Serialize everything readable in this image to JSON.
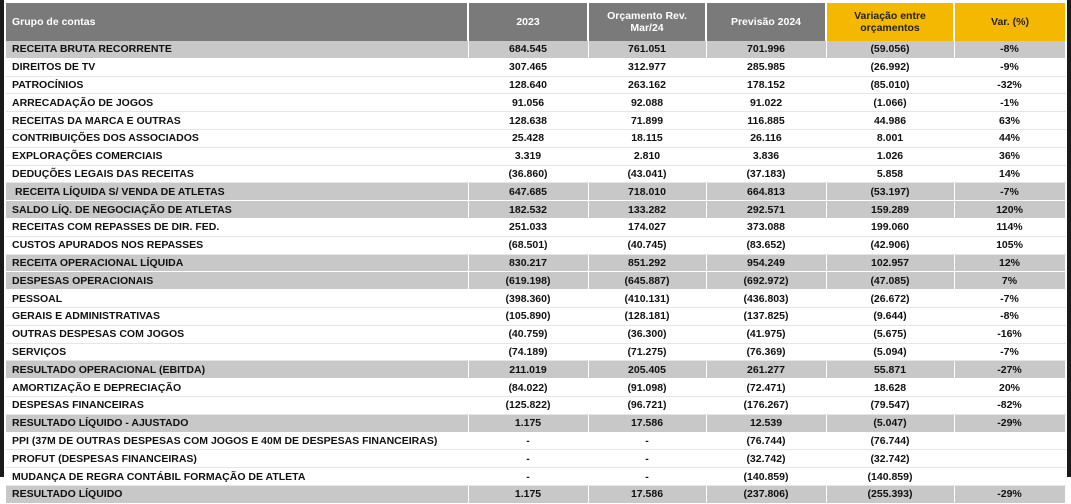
{
  "headers": [
    "Grupo de contas",
    "2023",
    "Orçamento Rev. Mar/24",
    "Previsão 2024",
    "Variação entre orçamentos",
    "Var. (%)"
  ],
  "rows": [
    {
      "label": "RECEITA BRUTA RECORRENTE",
      "v2023": "684.545",
      "orc": "761.051",
      "prev": "701.996",
      "var": "(59.056)",
      "pct": "-8%",
      "style": "total"
    },
    {
      "label": "DIREITOS DE TV",
      "v2023": "307.465",
      "orc": "312.977",
      "prev": "285.985",
      "var": "(26.992)",
      "pct": "-9%",
      "style": "normal"
    },
    {
      "label": "PATROCÍNIOS",
      "v2023": "128.640",
      "orc": "263.162",
      "prev": "178.152",
      "var": "(85.010)",
      "pct": "-32%",
      "style": "normal"
    },
    {
      "label": "ARRECADAÇÃO DE JOGOS",
      "v2023": "91.056",
      "orc": "92.088",
      "prev": "91.022",
      "var": "(1.066)",
      "pct": "-1%",
      "style": "normal"
    },
    {
      "label": "RECEITAS DA MARCA E OUTRAS",
      "v2023": "128.638",
      "orc": "71.899",
      "prev": "116.885",
      "var": "44.986",
      "pct": "63%",
      "style": "normal"
    },
    {
      "label": "CONTRIBUIÇÕES DOS ASSOCIADOS",
      "v2023": "25.428",
      "orc": "18.115",
      "prev": "26.116",
      "var": "8.001",
      "pct": "44%",
      "style": "normal"
    },
    {
      "label": "EXPLORAÇÕES COMERCIAIS",
      "v2023": "3.319",
      "orc": "2.810",
      "prev": "3.836",
      "var": "1.026",
      "pct": "36%",
      "style": "normal"
    },
    {
      "label": "DEDUÇÕES LEGAIS DAS RECEITAS",
      "v2023": "(36.860)",
      "orc": "(43.041)",
      "prev": "(37.183)",
      "var": "5.858",
      "pct": "14%",
      "style": "normal"
    },
    {
      "label": "RECEITA LÍQUIDA S/ VENDA DE ATLETAS",
      "v2023": "647.685",
      "orc": "718.010",
      "prev": "664.813",
      "var": "(53.197)",
      "pct": "-7%",
      "style": "total indent"
    },
    {
      "label": "SALDO LÍQ. DE NEGOCIAÇÃO DE ATLETAS",
      "v2023": "182.532",
      "orc": "133.282",
      "prev": "292.571",
      "var": "159.289",
      "pct": "120%",
      "style": "total"
    },
    {
      "label": "RECEITAS COM REPASSES DE DIR. FED.",
      "v2023": "251.033",
      "orc": "174.027",
      "prev": "373.088",
      "var": "199.060",
      "pct": "114%",
      "style": "normal"
    },
    {
      "label": "CUSTOS APURADOS NOS REPASSES",
      "v2023": "(68.501)",
      "orc": "(40.745)",
      "prev": "(83.652)",
      "var": "(42.906)",
      "pct": "105%",
      "style": "normal"
    },
    {
      "label": "RECEITA OPERACIONAL LÍQUIDA",
      "v2023": "830.217",
      "orc": "851.292",
      "prev": "954.249",
      "var": "102.957",
      "pct": "12%",
      "style": "total"
    },
    {
      "label": "DESPESAS OPERACIONAIS",
      "v2023": "(619.198)",
      "orc": "(645.887)",
      "prev": "(692.972)",
      "var": "(47.085)",
      "pct": "7%",
      "style": "total"
    },
    {
      "label": "PESSOAL",
      "v2023": "(398.360)",
      "orc": "(410.131)",
      "prev": "(436.803)",
      "var": "(26.672)",
      "pct": "-7%",
      "style": "normal"
    },
    {
      "label": "GERAIS E ADMINISTRATIVAS",
      "v2023": "(105.890)",
      "orc": "(128.181)",
      "prev": "(137.825)",
      "var": "(9.644)",
      "pct": "-8%",
      "style": "normal"
    },
    {
      "label": "OUTRAS DESPESAS COM JOGOS",
      "v2023": "(40.759)",
      "orc": "(36.300)",
      "prev": "(41.975)",
      "var": "(5.675)",
      "pct": "-16%",
      "style": "normal"
    },
    {
      "label": "SERVIÇOS",
      "v2023": "(74.189)",
      "orc": "(71.275)",
      "prev": "(76.369)",
      "var": "(5.094)",
      "pct": "-7%",
      "style": "normal"
    },
    {
      "label": "RESULTADO OPERACIONAL (EBITDA)",
      "v2023": "211.019",
      "orc": "205.405",
      "prev": "261.277",
      "var": "55.871",
      "pct": "-27%",
      "style": "total"
    },
    {
      "label": "AMORTIZAÇÃO E DEPRECIAÇÃO",
      "v2023": "(84.022)",
      "orc": "(91.098)",
      "prev": "(72.471)",
      "var": "18.628",
      "pct": "20%",
      "style": "normal"
    },
    {
      "label": "DESPESAS FINANCEIRAS",
      "v2023": "(125.822)",
      "orc": "(96.721)",
      "prev": "(176.267)",
      "var": "(79.547)",
      "pct": "-82%",
      "style": "normal"
    },
    {
      "label": "RESULTADO LÍQUIDO - AJUSTADO",
      "v2023": "1.175",
      "orc": "17.586",
      "prev": "12.539",
      "var": "(5.047)",
      "pct": "-29%",
      "style": "total"
    },
    {
      "label": "PPI (37M DE OUTRAS DESPESAS COM JOGOS E 40M DE DESPESAS FINANCEIRAS)",
      "v2023": "-",
      "orc": "-",
      "prev": "(76.744)",
      "var": "(76.744)",
      "pct": "",
      "style": "normal"
    },
    {
      "label": "PROFUT (DESPESAS FINANCEIRAS)",
      "v2023": "-",
      "orc": "-",
      "prev": "(32.742)",
      "var": "(32.742)",
      "pct": "",
      "style": "normal"
    },
    {
      "label": "MUDANÇA DE REGRA CONTÁBIL FORMAÇÃO DE ATLETA",
      "v2023": "-",
      "orc": "-",
      "prev": "(140.859)",
      "var": "(140.859)",
      "pct": "",
      "style": "normal"
    },
    {
      "label": "RESULTADO LÍQUIDO",
      "v2023": "1.175",
      "orc": "17.586",
      "prev": "(237.806)",
      "var": "(255.393)",
      "pct": "-29%",
      "style": "total"
    }
  ]
}
